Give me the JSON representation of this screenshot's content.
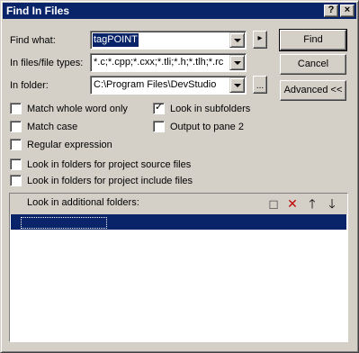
{
  "window": {
    "title": "Find In Files",
    "help_btn": "?",
    "close_btn": "×"
  },
  "form": {
    "find_what_label": "Find what:",
    "find_what_value": "tagPOINT",
    "file_types_label": "In files/file types:",
    "file_types_value": "*.c;*.cpp;*.cxx;*.tli;*.h;*.tlh;*.rc",
    "folder_label": "In folder:",
    "folder_value": "C:\\Program Files\\DevStudio",
    "arrow_btn": "▸",
    "browse_btn": "..."
  },
  "buttons": {
    "find": "Find",
    "cancel": "Cancel",
    "advanced": "Advanced <<"
  },
  "options": {
    "match_whole_word": {
      "label": "Match whole word only",
      "checked": false
    },
    "look_in_subfolders": {
      "label": "Look in subfolders",
      "checked": true
    },
    "match_case": {
      "label": "Match case",
      "checked": false
    },
    "output_to_pane2": {
      "label": "Output to pane 2",
      "checked": false
    },
    "regex": {
      "label": "Regular expression",
      "checked": false
    },
    "project_source": {
      "label": "Look in folders for project source files",
      "checked": false
    },
    "project_include": {
      "label": "Look in folders for project include files",
      "checked": false
    },
    "check_glyph": "✓"
  },
  "additional": {
    "header_label": "Look in additional folders:",
    "tools": {
      "new": "◻",
      "delete": "✕",
      "up": "🡑",
      "down": "🡓"
    }
  }
}
